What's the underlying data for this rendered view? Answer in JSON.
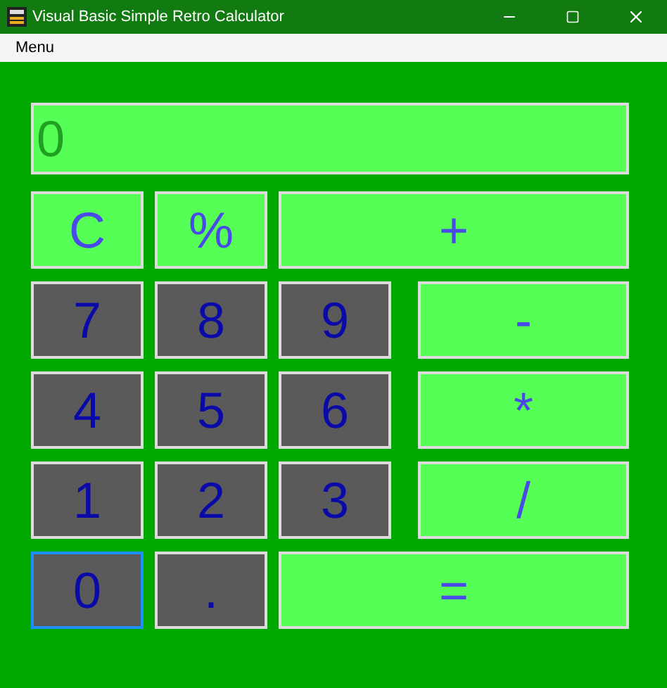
{
  "window": {
    "title": "Visual Basic Simple Retro Calculator"
  },
  "menu": [
    "Menu"
  ],
  "display": {
    "value": "0"
  },
  "rows": [
    [
      {
        "label": "C",
        "kind": "function",
        "focused": false
      },
      {
        "label": "%",
        "kind": "function",
        "focused": false
      },
      {
        "label": "+",
        "kind": "operator",
        "focused": false
      }
    ],
    [
      {
        "label": "7",
        "kind": "digit",
        "focused": false
      },
      {
        "label": "8",
        "kind": "digit",
        "focused": false
      },
      {
        "label": "9",
        "kind": "digit",
        "focused": false
      },
      {
        "label": "-",
        "kind": "operator",
        "focused": false
      }
    ],
    [
      {
        "label": "4",
        "kind": "digit",
        "focused": false
      },
      {
        "label": "5",
        "kind": "digit",
        "focused": false
      },
      {
        "label": "6",
        "kind": "digit",
        "focused": false
      },
      {
        "label": "*",
        "kind": "operator",
        "focused": false
      }
    ],
    [
      {
        "label": "1",
        "kind": "digit",
        "focused": false
      },
      {
        "label": "2",
        "kind": "digit",
        "focused": false
      },
      {
        "label": "3",
        "kind": "digit",
        "focused": false
      },
      {
        "label": "/",
        "kind": "operator",
        "focused": false
      }
    ],
    [
      {
        "label": "0",
        "kind": "digit",
        "focused": true
      },
      {
        "label": ".",
        "kind": "digit",
        "focused": false
      },
      {
        "label": "=",
        "kind": "operator",
        "focused": false
      }
    ]
  ]
}
